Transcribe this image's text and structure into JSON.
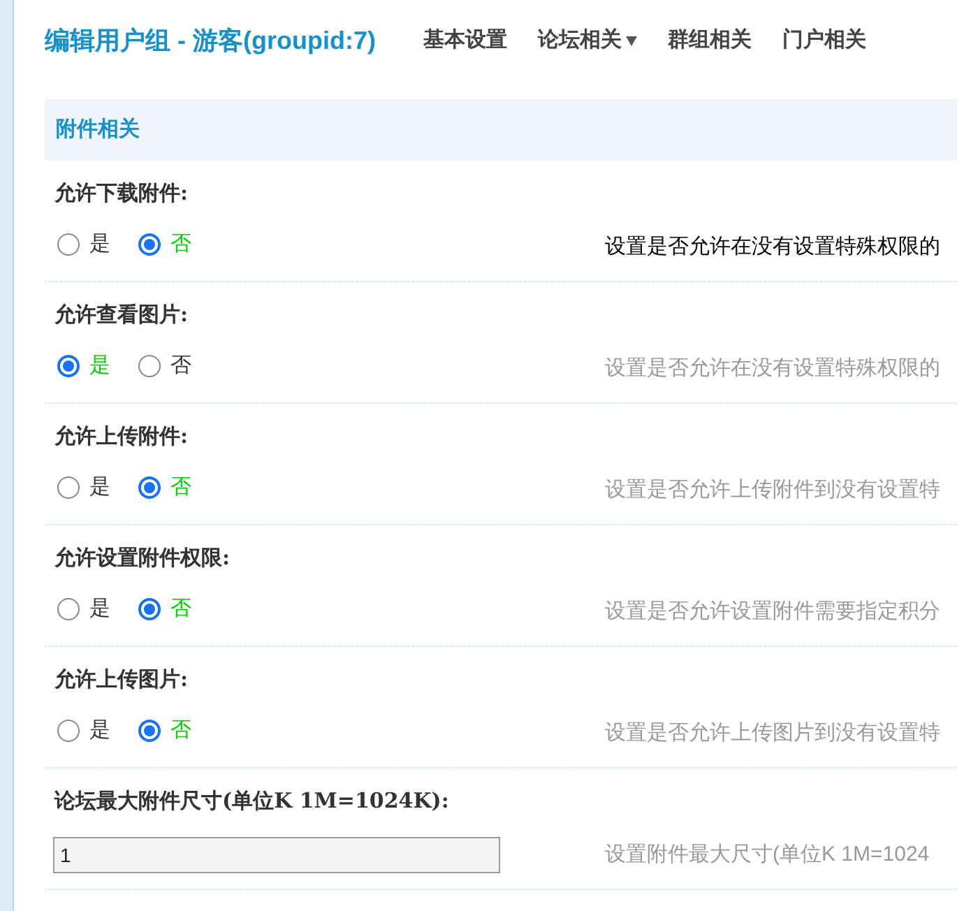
{
  "title": "编辑用户组 - 游客(groupid:7)",
  "nav": [
    {
      "label": "基本设置",
      "dropdown": false
    },
    {
      "label": "论坛相关",
      "dropdown": true
    },
    {
      "label": "群组相关",
      "dropdown": false
    },
    {
      "label": "门户相关",
      "dropdown": false
    }
  ],
  "section": "附件相关",
  "settings": [
    {
      "kind": "radio",
      "label": "允许下载附件:",
      "options": [
        {
          "label": "是",
          "selected": false
        },
        {
          "label": "否",
          "selected": true
        }
      ],
      "description": "设置是否允许在没有设置特殊权限的",
      "highlighted": true
    },
    {
      "kind": "radio",
      "label": "允许查看图片:",
      "options": [
        {
          "label": "是",
          "selected": true
        },
        {
          "label": "否",
          "selected": false
        }
      ],
      "description": "设置是否允许在没有设置特殊权限的",
      "highlighted": false
    },
    {
      "kind": "radio",
      "label": "允许上传附件:",
      "options": [
        {
          "label": "是",
          "selected": false
        },
        {
          "label": "否",
          "selected": true
        }
      ],
      "description": "设置是否允许上传附件到没有设置特",
      "highlighted": false
    },
    {
      "kind": "radio",
      "label": "允许设置附件权限:",
      "options": [
        {
          "label": "是",
          "selected": false
        },
        {
          "label": "否",
          "selected": true
        }
      ],
      "description": "设置是否允许设置附件需要指定积分",
      "highlighted": false
    },
    {
      "kind": "radio",
      "label": "允许上传图片:",
      "options": [
        {
          "label": "是",
          "selected": false
        },
        {
          "label": "否",
          "selected": true
        }
      ],
      "description": "设置是否允许上传图片到没有设置特",
      "highlighted": false
    },
    {
      "kind": "text",
      "label": "论坛最大附件尺寸(单位K 1M=1024K):",
      "value": "1",
      "description": "设置附件最大尺寸(单位K 1M=1024",
      "highlighted": false
    }
  ]
}
